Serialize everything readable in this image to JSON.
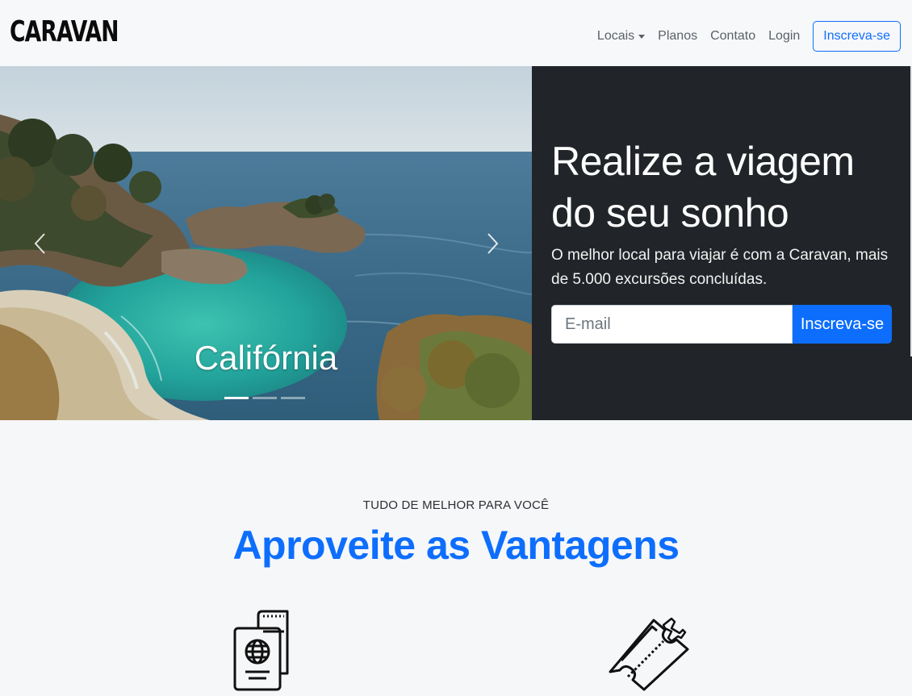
{
  "brand": {
    "name": "CARAVAN"
  },
  "nav": {
    "items": [
      {
        "label": "Locais",
        "dropdown": true
      },
      {
        "label": "Planos"
      },
      {
        "label": "Contato"
      },
      {
        "label": "Login"
      }
    ],
    "cta": "Inscreva-se"
  },
  "carousel": {
    "caption": "Califórnia",
    "slide_count": 3,
    "active_index": 0,
    "icons": {
      "prev": "chevron-left-icon",
      "next": "chevron-right-icon"
    }
  },
  "hero": {
    "title": "Realize a viagem do seu sonho",
    "text": "O melhor local para viajar é com a Caravan, mais de 5.000 excursões concluídas.",
    "email_placeholder": "E-mail",
    "email_value": "",
    "submit_label": "Inscreva-se"
  },
  "benefits": {
    "eyebrow": "TUDO DE MELHOR PARA VOCÊ",
    "title": "Aproveite as Vantagens",
    "icons": [
      "passport-icon",
      "plane-ticket-icon"
    ]
  },
  "colors": {
    "accent": "#0d6efd",
    "hero_panel": "#212529",
    "background": "#f6f7f9"
  }
}
